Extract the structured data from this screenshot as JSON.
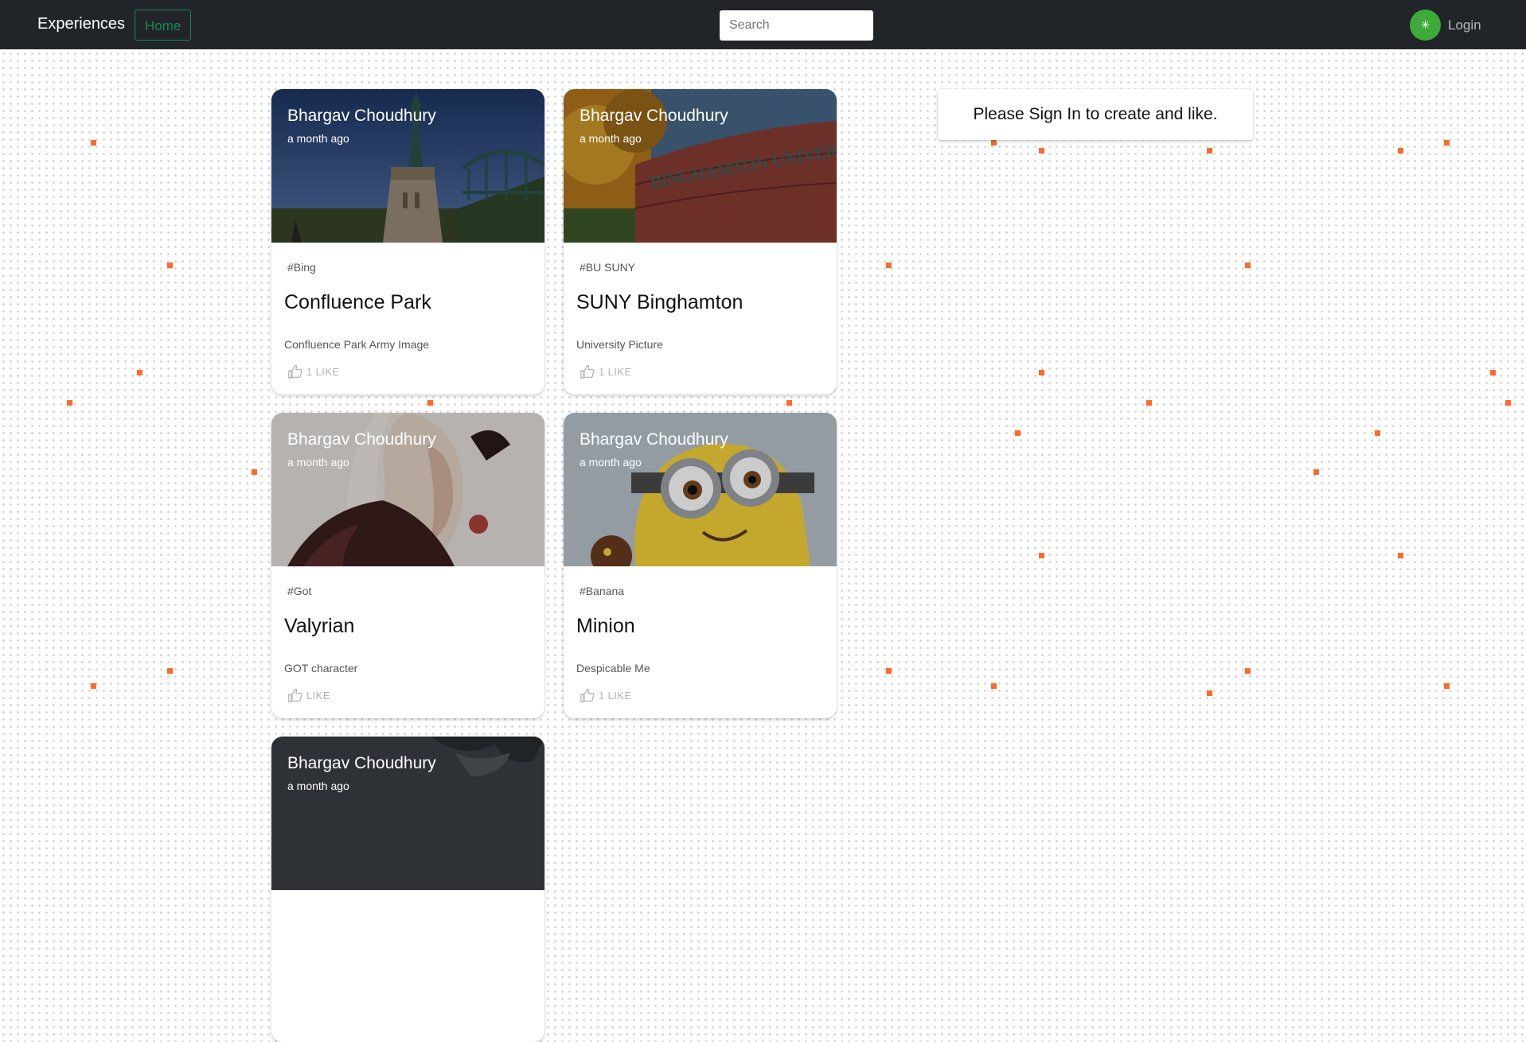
{
  "navbar": {
    "brand": "Experiences",
    "home_label": "Home",
    "search_placeholder": "Search",
    "avatar_glyph": "✳",
    "login_label": "Login"
  },
  "cards": [
    {
      "author": "Bhargav Choudhury",
      "time": "a month ago",
      "tag": "#Bing",
      "title": "Confluence Park",
      "description": "Confluence Park Army Image",
      "likes": "1 LIKE"
    },
    {
      "author": "Bhargav Choudhury",
      "time": "a month ago",
      "tag": "#BU SUNY",
      "title": "SUNY Binghamton",
      "description": "University Picture",
      "likes": "1 LIKE"
    },
    {
      "author": "Bhargav Choudhury",
      "time": "a month ago",
      "tag": "#Got",
      "title": "Valyrian",
      "description": "GOT character",
      "likes": "LIKE"
    },
    {
      "author": "Bhargav Choudhury",
      "time": "a month ago",
      "tag": "#Banana",
      "title": "Minion",
      "description": "Despicable Me",
      "likes": "1 LIKE"
    },
    {
      "author": "Bhargav Choudhury",
      "time": "a month ago"
    }
  ],
  "sidebar": {
    "signin_message": "Please Sign In to create and like."
  },
  "colors": {
    "navbar_bg": "#212529",
    "home_outline": "#198754",
    "avatar_bg": "#3daa3a",
    "accent_dots": "#ff6a2b"
  }
}
